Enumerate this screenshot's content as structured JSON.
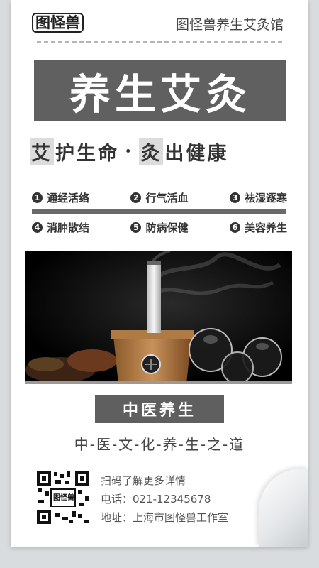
{
  "brand": {
    "logo_text": "图怪兽"
  },
  "header": {
    "title": "图怪兽养生艾灸馆"
  },
  "main": {
    "title": "养生艾灸"
  },
  "slogan": {
    "part1_highlight": "艾",
    "part1_rest": "护生命",
    "separator": "·",
    "part2_highlight": "灸",
    "part2_rest": "出健康"
  },
  "benefits": [
    {
      "num": "1",
      "text": "通经活络"
    },
    {
      "num": "2",
      "text": "行气活血"
    },
    {
      "num": "3",
      "text": "祛湿逐寒"
    },
    {
      "num": "4",
      "text": "消肿散结"
    },
    {
      "num": "5",
      "text": "防病保健"
    },
    {
      "num": "6",
      "text": "美容养生"
    }
  ],
  "section": {
    "label": "中医养生",
    "tagline": "中-医-文-化-养-生-之-道"
  },
  "qr": {
    "logo_text": "图怪兽"
  },
  "contact": {
    "scan": "扫码了解更多详情",
    "phone": "电话：021-12345678",
    "address": "地址：上海市图怪兽工作室"
  },
  "colors": {
    "banner": "#606060",
    "text_dark": "#333333",
    "background": "#d9dcde"
  }
}
